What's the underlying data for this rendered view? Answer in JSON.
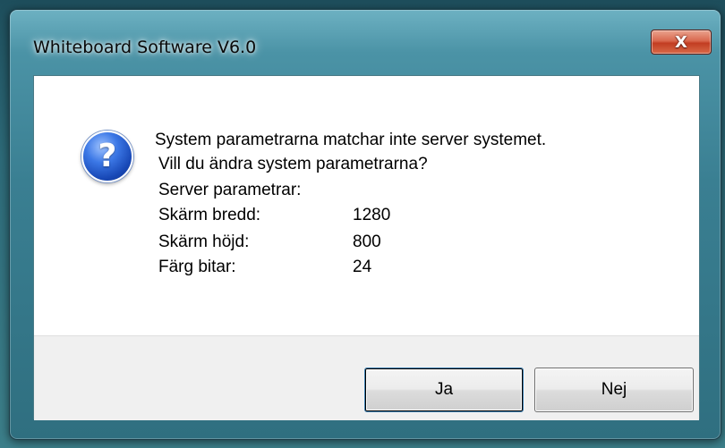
{
  "window": {
    "title": "Whiteboard Software V6.0",
    "close_glyph": "X"
  },
  "icon": {
    "name": "question-icon",
    "glyph": "?"
  },
  "message": {
    "line1": "System parametrarna matchar inte server systemet.",
    "line2": "Vill du ändra system parametrarna?",
    "line3": "Server parametrar:",
    "params": [
      {
        "label": "Skärm bredd:",
        "value": "1280"
      },
      {
        "label": "Skärm höjd:",
        "value": "800"
      },
      {
        "label": "Färg bitar:",
        "value": "24"
      }
    ]
  },
  "buttons": {
    "yes_label": "Ja",
    "no_label": "Nej"
  }
}
